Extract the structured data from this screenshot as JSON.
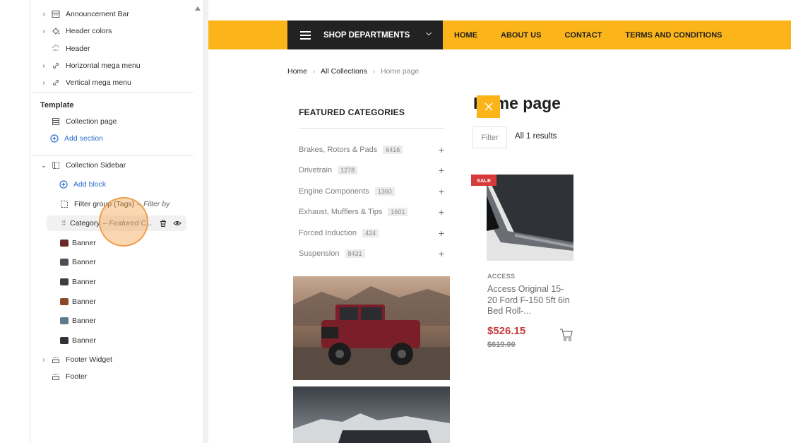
{
  "editor": {
    "header_items": [
      {
        "label": "Announcement Bar",
        "icon": "announcement-bar-icon",
        "expandable": true
      },
      {
        "label": "Header colors",
        "icon": "paint-bucket-icon",
        "expandable": true
      },
      {
        "label": "Header",
        "icon": "header-icon",
        "expandable": false
      },
      {
        "label": "Horizontal mega menu",
        "icon": "link-icon",
        "expandable": true
      },
      {
        "label": "Vertical mega menu",
        "icon": "link-icon",
        "expandable": true
      }
    ],
    "template_title": "Template",
    "template_items": {
      "collection_page": "Collection page",
      "add_section": "Add section"
    },
    "sidebar_section": {
      "label": "Collection Sidebar",
      "add_block": "Add block",
      "filter_group": {
        "label": "Filter group (Tags)",
        "detail": "– Filter by"
      },
      "category": {
        "label": "Category",
        "detail": "– Featured C..."
      },
      "banners": [
        {
          "label": "Banner",
          "thumb_color": "#6b2a2a"
        },
        {
          "label": "Banner",
          "thumb_color": "#4a4f55"
        },
        {
          "label": "Banner",
          "thumb_color": "#3b3f43"
        },
        {
          "label": "Banner",
          "thumb_color": "#8a4a2a"
        },
        {
          "label": "Banner",
          "thumb_color": "#5f7a8c"
        },
        {
          "label": "Banner",
          "thumb_color": "#2f3338"
        }
      ]
    },
    "footer_items": [
      {
        "label": "Footer Widget",
        "expandable": true
      },
      {
        "label": "Footer",
        "expandable": false
      }
    ]
  },
  "store": {
    "nav": {
      "departments": "SHOP DEPARTMENTS",
      "links": [
        "HOME",
        "ABOUT US",
        "CONTACT",
        "TERMS AND CONDITIONS"
      ]
    },
    "breadcrumb": [
      "Home",
      "All Collections",
      "Home page"
    ],
    "featured": {
      "title": "FEATURED CATEGORIES",
      "categories": [
        {
          "name": "Brakes, Rotors & Pads",
          "count": "6416"
        },
        {
          "name": "Drivetrain",
          "count": "1278"
        },
        {
          "name": "Engine Components",
          "count": "1360"
        },
        {
          "name": "Exhaust, Mufflers & Tips",
          "count": "1601"
        },
        {
          "name": "Forced Induction",
          "count": "424"
        },
        {
          "name": "Suspension",
          "count": "8431"
        }
      ]
    },
    "page_title": "Home page",
    "filter_label": "Filter",
    "results": "All 1 results",
    "product": {
      "badge": "SALE",
      "brand": "ACCESS",
      "name": "Access Original 15-20 Ford F-150 5ft 6in Bed Roll-...",
      "price": "$526.15",
      "old_price": "$619.00"
    }
  },
  "colors": {
    "accent_yellow": "#fbb41a",
    "dark": "#222222",
    "sale_red": "#d63a3a",
    "link_blue": "#2c6ecb"
  }
}
